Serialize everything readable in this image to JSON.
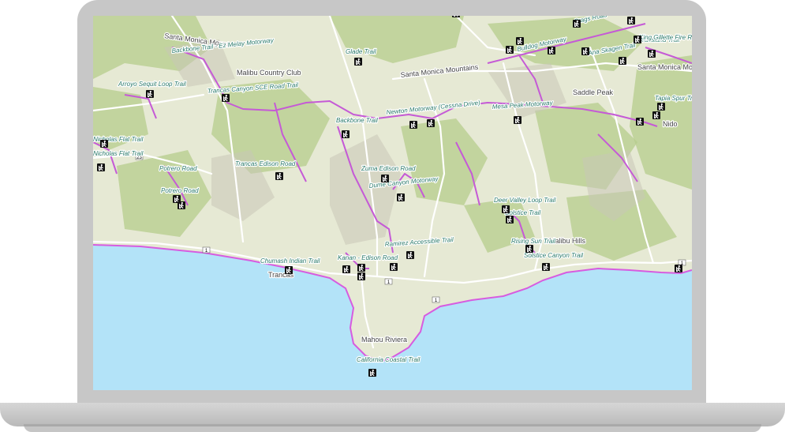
{
  "map": {
    "colors": {
      "ocean": "#b3e3f8",
      "coastline": "#d75ce0",
      "trail": "#c55ad6",
      "terrain": "#e6e9d4",
      "vegetation": "#b6cc8c",
      "road": "#ffffff",
      "label": "#2a7a6a"
    },
    "trail_labels": [
      "Backbone Trail - Ez Melay Motorway",
      "Arroyo Sequit Loop Trail",
      "Trancas Canyon SCE Road Trail",
      "Glade Trail",
      "Backbone Trail",
      "Newton Motorway (Cessna Drive)",
      "Mesa Peak Motorway",
      "Bulldog Motorway",
      "Crags Road",
      "Grassland Trail",
      "King Gillette Fire Road",
      "Ana Skagen Trail",
      "Tapia Spur Trail",
      "Trancas Edison Road",
      "Potrero Road",
      "Potrero Road",
      "Nicholas Flat Trail",
      "Nicholas Flat Trail",
      "Zuma Edison Road",
      "Dume Canyon Motorway",
      "Deer Valley Loop Trail",
      "Solstice Trail",
      "Rising Sun Trail",
      "Solstice Canyon Trail",
      "Ramirez Accessible Trail",
      "Chumash Indian Trail",
      "Kanan - Edison Road",
      "California Coastal Trail"
    ],
    "place_labels": [
      "Santa Monica Mount",
      "Malibu Country Club",
      "Santa Monica Mountains",
      "Trancas",
      "Mahou Riviera",
      "Malibu Hills",
      "Saddle Peak",
      "Nido",
      "Santa Monica Mount"
    ],
    "route_shields": [
      "1",
      "1",
      "1",
      "1",
      "23"
    ],
    "trailhead_icon": "hiker-icon"
  }
}
